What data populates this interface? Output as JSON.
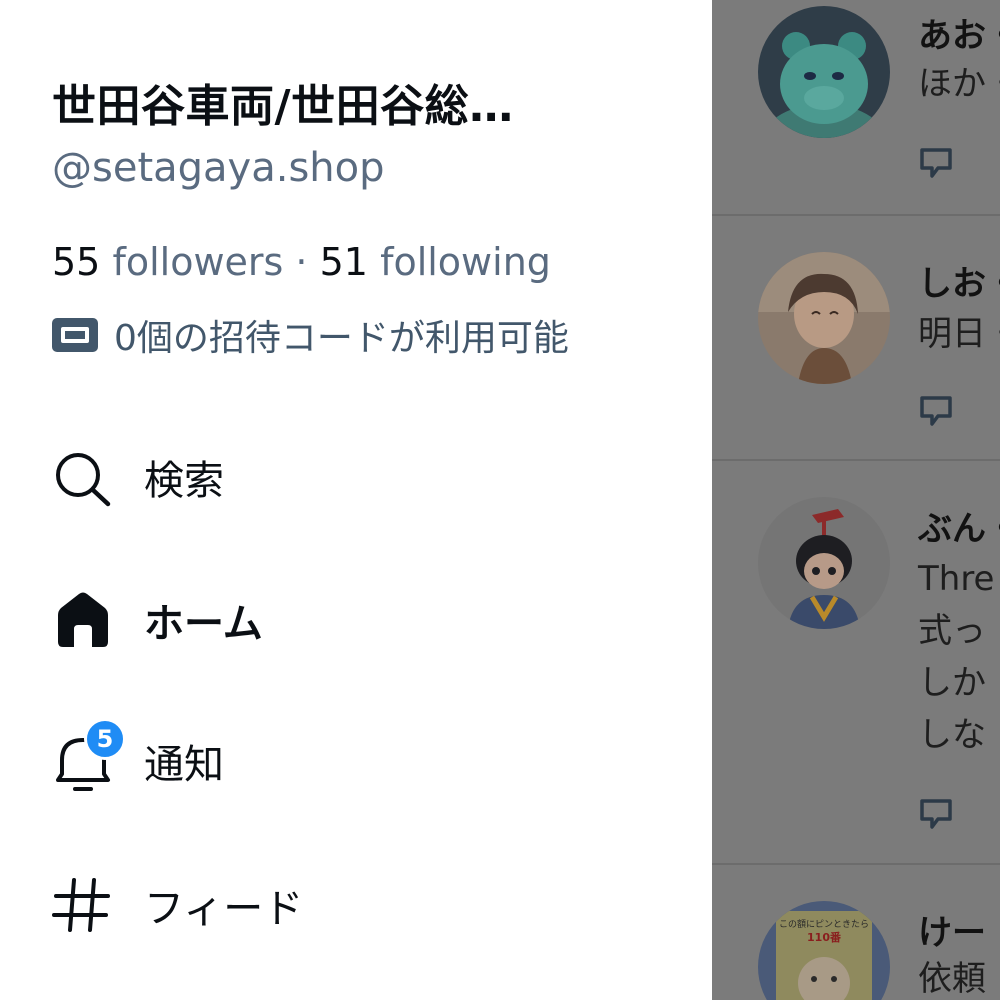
{
  "profile": {
    "display_name": "世田谷車両/世田谷総…",
    "handle": "@setagaya.shop",
    "followers_count": "55",
    "followers_label": "followers",
    "separator": "·",
    "following_count": "51",
    "following_label": "following",
    "invite_text": "0個の招待コードが利用可能"
  },
  "nav": {
    "search": "検索",
    "home": "ホーム",
    "notifications": "通知",
    "notifications_badge": "5",
    "feeds": "フィード"
  },
  "feed": {
    "posts": [
      {
        "author": "あお・",
        "lines": [
          "ほか・"
        ]
      },
      {
        "author": "しお・",
        "lines": [
          "明日・"
        ]
      },
      {
        "author": "ぶん・",
        "lines": [
          "Thre",
          "式っ",
          "しか",
          "しな"
        ]
      },
      {
        "author": "けー",
        "lines": [
          "依頼"
        ],
        "avatar_text": [
          "この額にピンときたら",
          "110番"
        ]
      }
    ]
  },
  "colors": {
    "accent_badge": "#1f8cf5",
    "muted_text": "#5a6b80",
    "overlay": "#7b7b7b"
  }
}
